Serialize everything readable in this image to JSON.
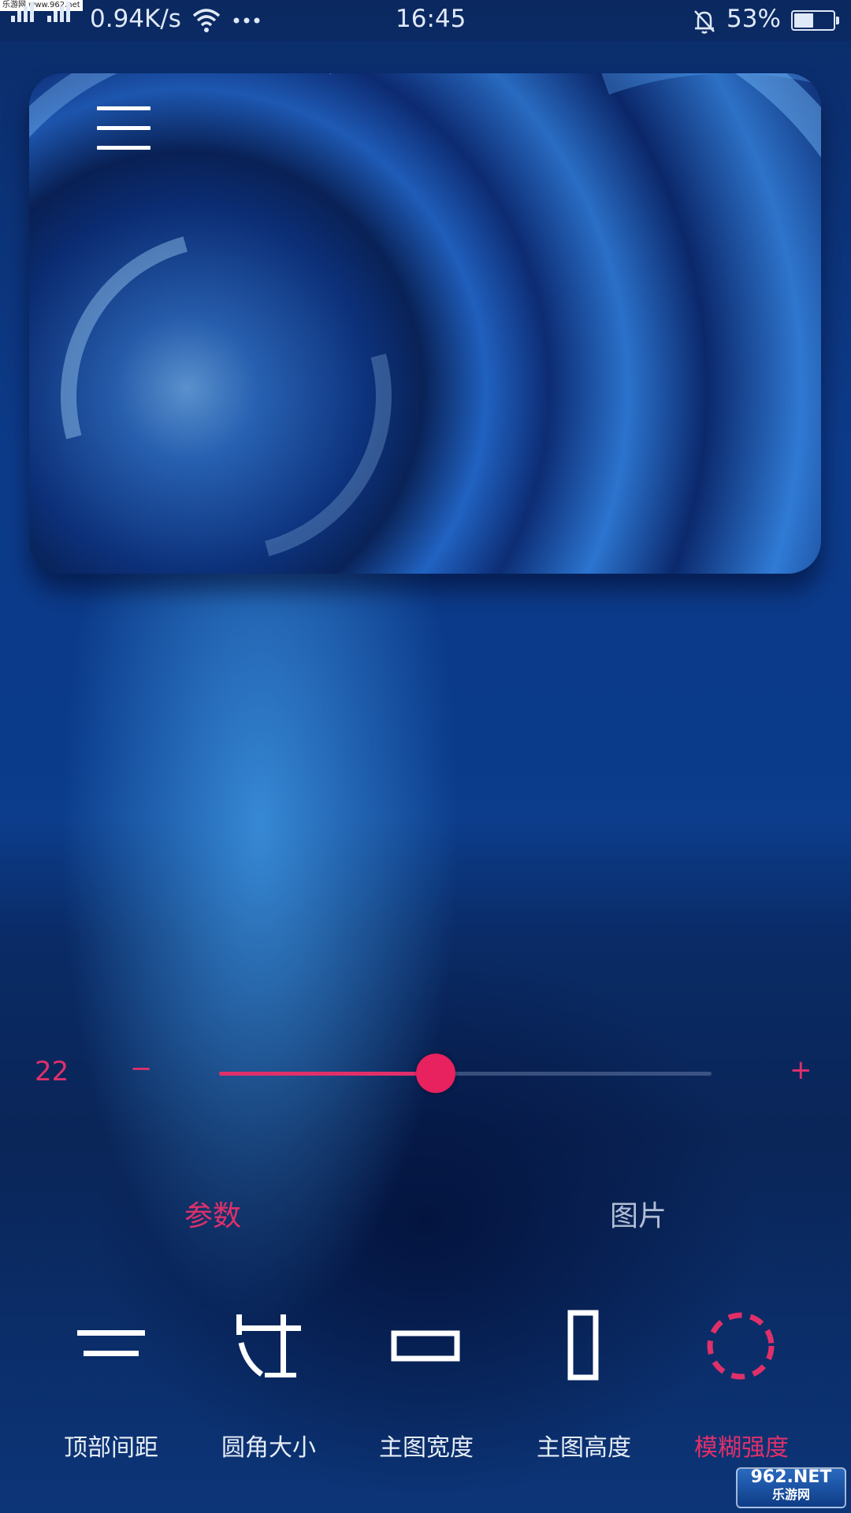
{
  "status_bar": {
    "tag": "乐游网 www.962.net",
    "network_speed": "0.94K/s",
    "time": "16:45",
    "battery_percent": "53%",
    "battery_level": 0.53
  },
  "card": {
    "menu_icon": "hamburger-menu-icon"
  },
  "slider": {
    "value": "22",
    "minus_label": "−",
    "plus_label": "+",
    "fill_fraction": 0.44,
    "accent_color": "#e0306a"
  },
  "tabs": [
    {
      "label": "参数",
      "active": true
    },
    {
      "label": "图片",
      "active": false
    }
  ],
  "tools": [
    {
      "label": "顶部间距",
      "icon": "top-spacing-icon",
      "active": false
    },
    {
      "label": "圆角大小",
      "icon": "corner-radius-icon",
      "active": false
    },
    {
      "label": "主图宽度",
      "icon": "image-width-icon",
      "active": false
    },
    {
      "label": "主图高度",
      "icon": "image-height-icon",
      "active": false
    },
    {
      "label": "模糊强度",
      "icon": "blur-strength-icon",
      "active": true
    }
  ],
  "watermark": {
    "top": "962.NET",
    "bottom": "乐游网"
  }
}
